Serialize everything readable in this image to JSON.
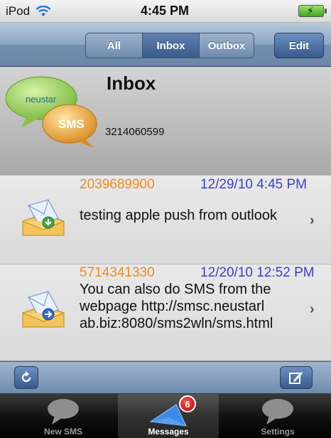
{
  "status_bar": {
    "carrier": "iPod",
    "time": "4:45 PM",
    "battery_icon": "battery-charging-icon",
    "wifi_icon": "wifi-icon"
  },
  "nav_bar": {
    "segments": [
      {
        "label": "All",
        "selected": false
      },
      {
        "label": "Inbox",
        "selected": true
      },
      {
        "label": "Outbox",
        "selected": false
      }
    ],
    "edit_label": "Edit"
  },
  "header": {
    "title": "Inbox",
    "phone_number": "3214060599",
    "logo_text_top": "neustar",
    "logo_text_bottom": "SMS"
  },
  "messages": [
    {
      "sender": "2039689900",
      "date": "12/29/10 4:45 PM",
      "body": "testing apple push from outlook",
      "icon": "envelope-received-icon"
    },
    {
      "sender": "5714341330",
      "date": "12/20/10 12:52 PM",
      "body": "You can also do SMS from the webpage http://smsc.neustarl ab.biz:8080/sms2wln/sms.html",
      "icon": "envelope-sent-icon"
    }
  ],
  "toolbar": {
    "refresh_icon": "refresh-icon",
    "compose_icon": "compose-icon"
  },
  "tab_bar": {
    "tabs": [
      {
        "label": "New SMS",
        "icon": "speech-bubble-icon",
        "selected": false
      },
      {
        "label": "Messages",
        "icon": "messages-icon",
        "selected": true,
        "badge": "6"
      },
      {
        "label": "Settings",
        "icon": "speech-bubble-icon",
        "selected": false
      }
    ]
  },
  "colors": {
    "sender": "#f08a1c",
    "date": "#3a3fd0",
    "nav_bar": "#7590af"
  }
}
